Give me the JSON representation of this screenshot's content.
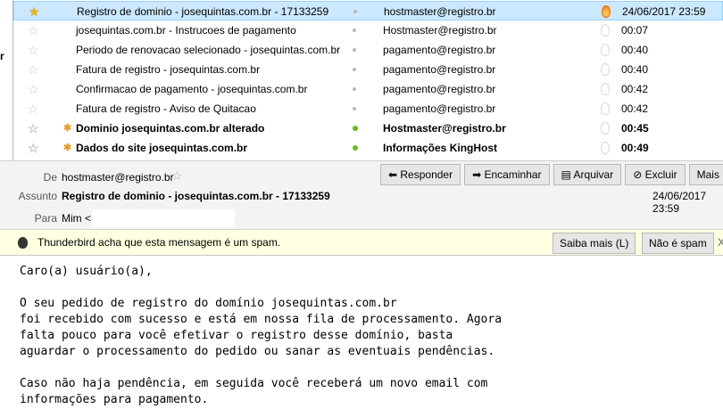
{
  "left_stub": "r",
  "messages": [
    {
      "starred": true,
      "unread": false,
      "subject": "Registro de dominio - josequintas.com.br - 17133259",
      "sender": "hostmaster@registro.br",
      "date": "24/06/2017 23:59",
      "junk": true,
      "selected": true
    },
    {
      "starred": false,
      "unread": false,
      "subject": "josequintas.com.br - Instrucoes de pagamento",
      "sender": "Hostmaster@registro.br",
      "date": "00:07"
    },
    {
      "starred": false,
      "unread": false,
      "subject": "Periodo de renovacao selecionado - josequintas.com.br",
      "sender": "pagamento@registro.br",
      "date": "00:40"
    },
    {
      "starred": false,
      "unread": false,
      "subject": "Fatura de registro - josequintas.com.br",
      "sender": "pagamento@registro.br",
      "date": "00:40"
    },
    {
      "starred": false,
      "unread": false,
      "subject": "Confirmacao de pagamento - josequintas.com.br",
      "sender": "pagamento@registro.br",
      "date": "00:42"
    },
    {
      "starred": false,
      "unread": false,
      "subject": "Fatura de registro - Aviso de Quitacao",
      "sender": "pagamento@registro.br",
      "date": "00:42"
    },
    {
      "starred": false,
      "unread": true,
      "subject": "Dominio josequintas.com.br alterado",
      "sender": "Hostmaster@registro.br",
      "date": "00:45"
    },
    {
      "starred": false,
      "unread": true,
      "subject": "Dados do site josequintas.com.br",
      "sender": "Informações KingHost",
      "date": "00:49"
    }
  ],
  "header": {
    "from_label": "De",
    "from": "hostmaster@registro.br",
    "subject_label": "Assunto",
    "subject": "Registro de dominio - josequintas.com.br - 17133259",
    "to_label": "Para",
    "to": "Mim <",
    "date": "24/06/2017 23:59",
    "buttons": {
      "reply": "Responder",
      "forward": "Encaminhar",
      "archive": "Arquivar",
      "delete": "Excluir",
      "more": "Mais"
    }
  },
  "spam_bar": {
    "text": "Thunderbird acha que esta mensagem é um spam.",
    "learn_more": "Saiba mais (L)",
    "not_spam": "Não é spam",
    "close": "X"
  },
  "body": "Caro(a) usuário(a),\n\nO seu pedido de registro do domínio josequintas.com.br\nfoi recebido com sucesso e está em nossa fila de processamento. Agora\nfalta pouco para você efetivar o registro desse domínio, basta\naguardar o processamento do pedido ou sanar as eventuais pendências.\n\nCaso não haja pendência, em seguida você receberá um novo email com\ninformações para pagamento."
}
